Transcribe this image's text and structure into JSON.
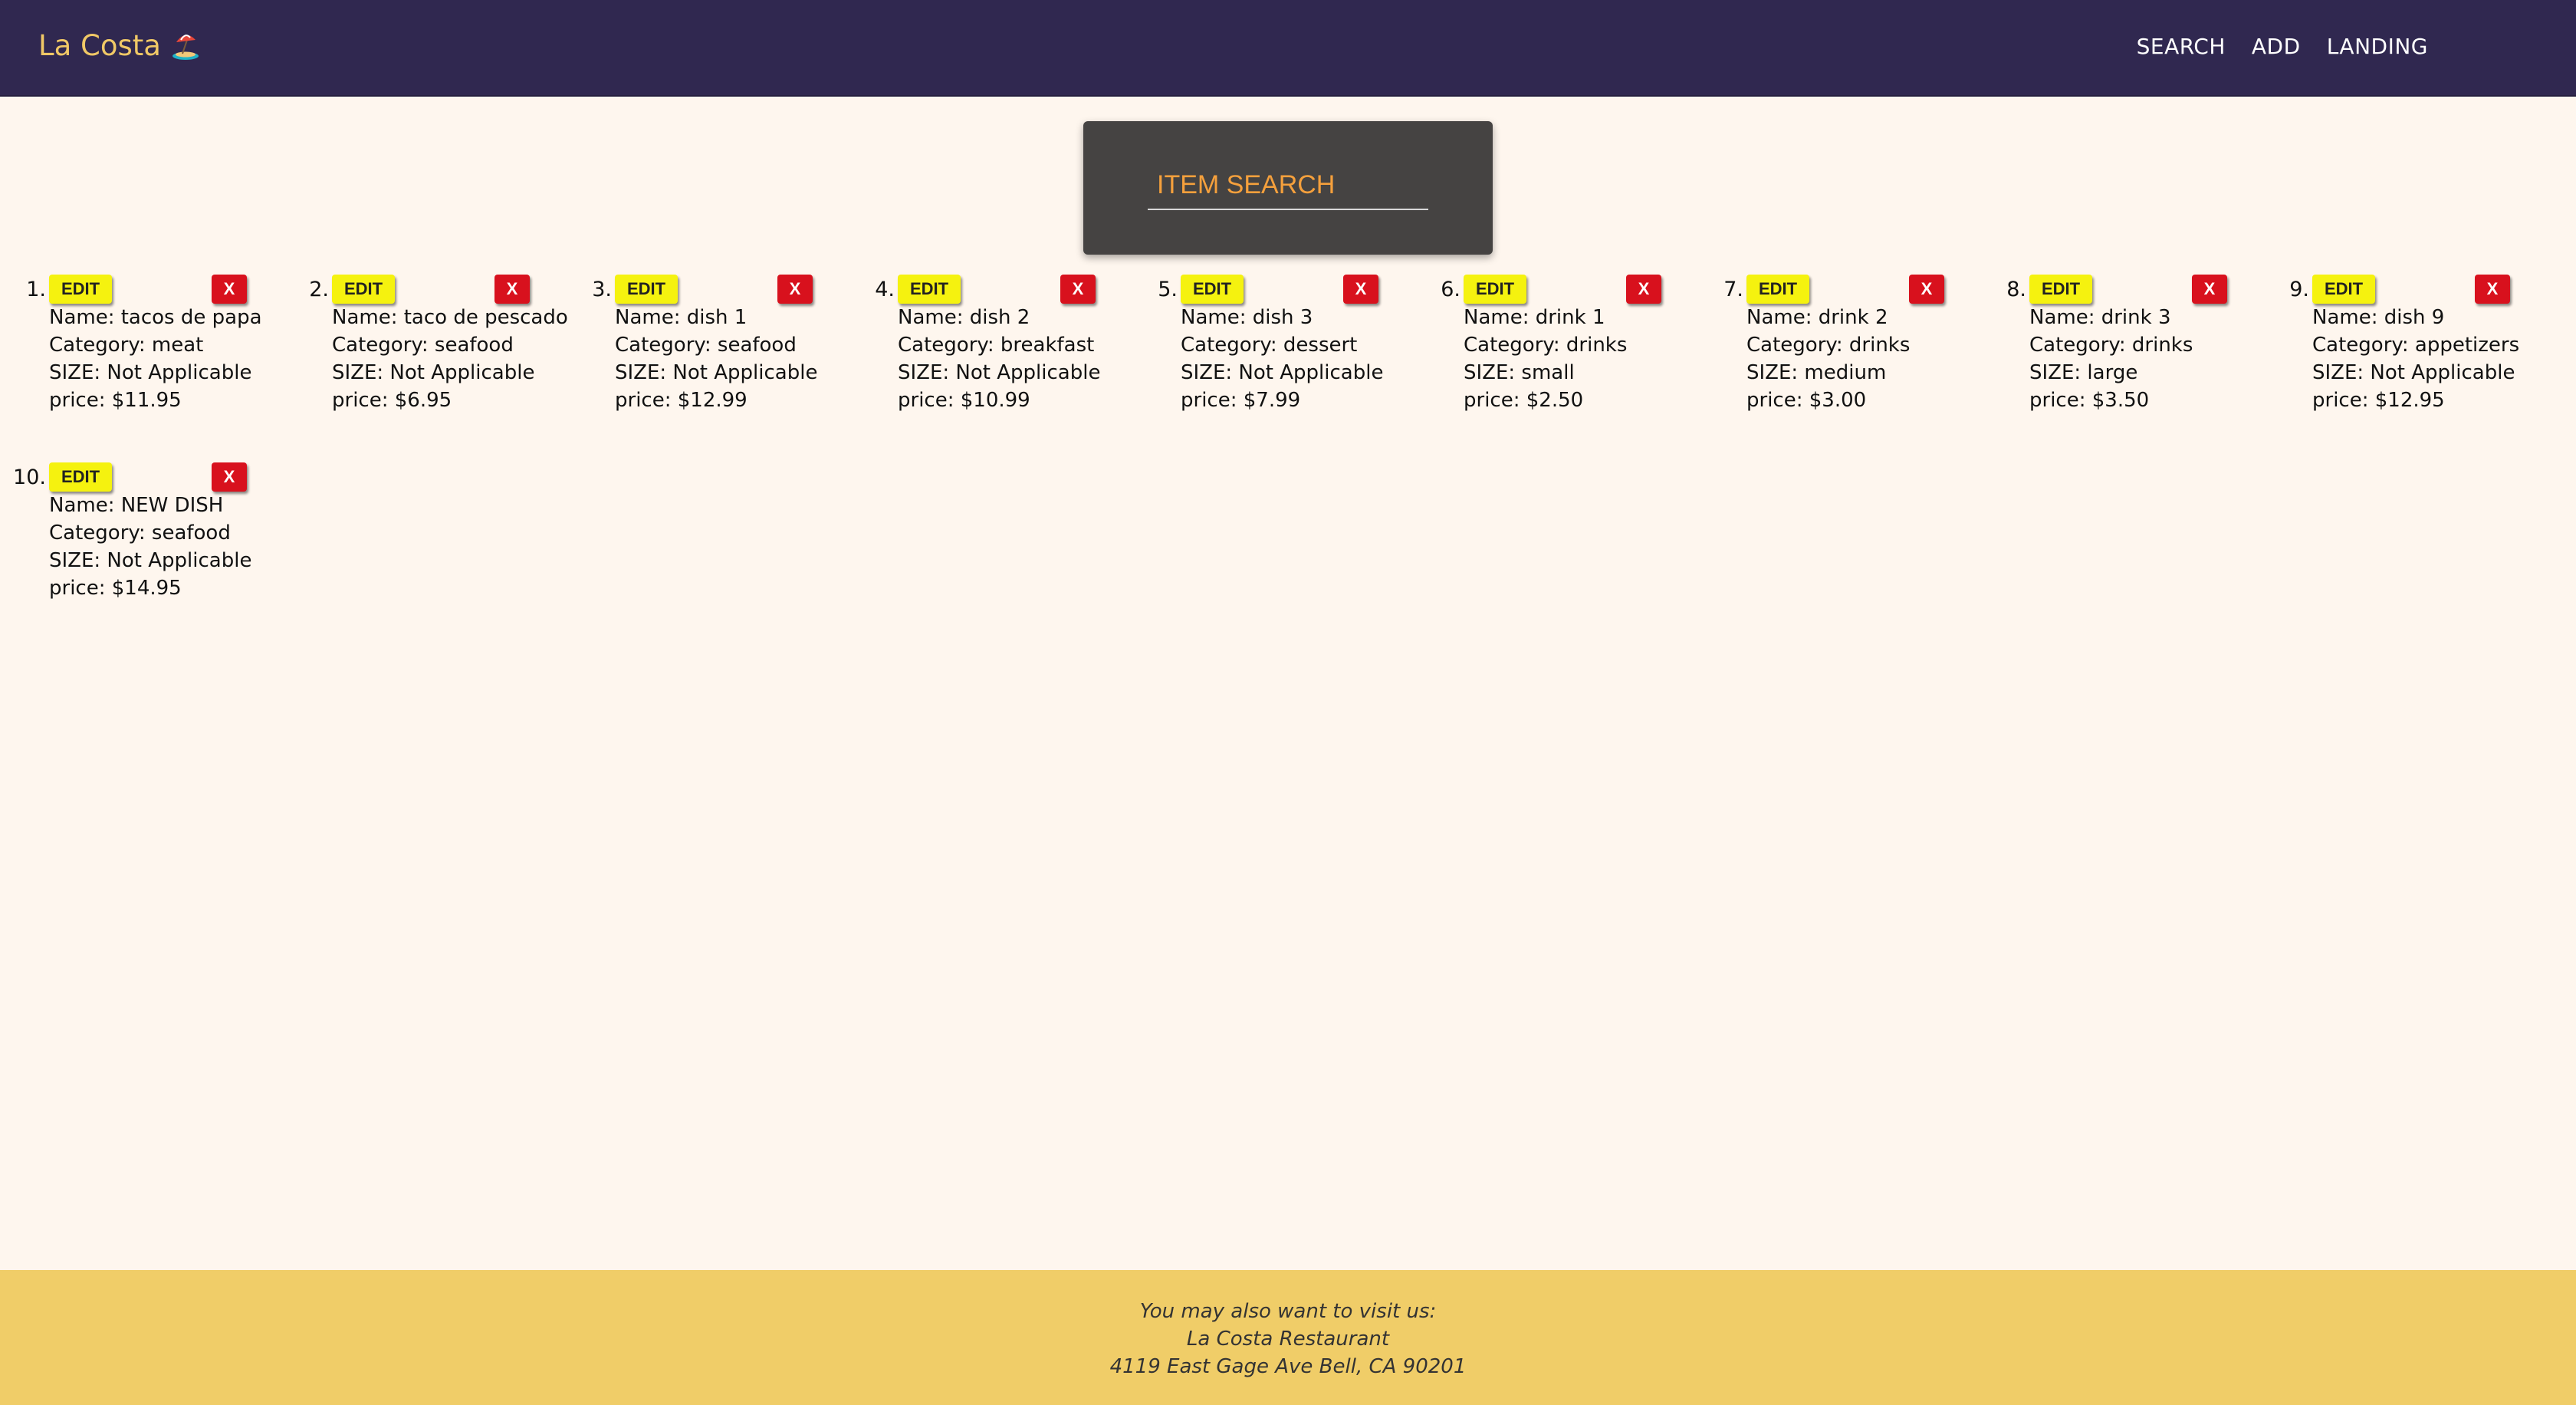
{
  "header": {
    "brand": "La Costa",
    "brand_icon": "beach-umbrella-icon",
    "nav": [
      "SEARCH",
      "ADD",
      "LANDING"
    ]
  },
  "search": {
    "placeholder": "ITEM SEARCH",
    "value": ""
  },
  "items": [
    {
      "index": "1.",
      "edit": "EDIT",
      "delete": "X",
      "name": "Name: tacos de papa",
      "category": "Category: meat",
      "size": "SIZE: Not Applicable",
      "price": "price: $11.95"
    },
    {
      "index": "2.",
      "edit": "EDIT",
      "delete": "X",
      "name": "Name: taco de pescado",
      "category": "Category: seafood",
      "size": "SIZE: Not Applicable",
      "price": "price: $6.95"
    },
    {
      "index": "3.",
      "edit": "EDIT",
      "delete": "X",
      "name": "Name: dish 1",
      "category": "Category: seafood",
      "size": "SIZE: Not Applicable",
      "price": "price: $12.99"
    },
    {
      "index": "4.",
      "edit": "EDIT",
      "delete": "X",
      "name": "Name: dish 2",
      "category": "Category: breakfast",
      "size": "SIZE: Not Applicable",
      "price": "price: $10.99"
    },
    {
      "index": "5.",
      "edit": "EDIT",
      "delete": "X",
      "name": "Name: dish 3",
      "category": "Category: dessert",
      "size": "SIZE: Not Applicable",
      "price": "price: $7.99"
    },
    {
      "index": "6.",
      "edit": "EDIT",
      "delete": "X",
      "name": "Name: drink 1",
      "category": "Category: drinks",
      "size": "SIZE: small",
      "price": "price: $2.50"
    },
    {
      "index": "7.",
      "edit": "EDIT",
      "delete": "X",
      "name": "Name: drink 2",
      "category": "Category: drinks",
      "size": "SIZE: medium",
      "price": "price: $3.00"
    },
    {
      "index": "8.",
      "edit": "EDIT",
      "delete": "X",
      "name": "Name: drink 3",
      "category": "Category: drinks",
      "size": "SIZE: large",
      "price": "price: $3.50"
    },
    {
      "index": "9.",
      "edit": "EDIT",
      "delete": "X",
      "name": "Name: dish 9",
      "category": "Category: appetizers",
      "size": "SIZE: Not Applicable",
      "price": "price: $12.95"
    },
    {
      "index": "10.",
      "edit": "EDIT",
      "delete": "X",
      "name": "Name: NEW DISH",
      "category": "Category: seafood",
      "size": "SIZE: Not Applicable",
      "price": "price: $14.95"
    }
  ],
  "footer": {
    "line1": "You may also want to visit us:",
    "line2": "La Costa Restaurant",
    "line3": "4119 East Gage Ave Bell, CA 90201"
  },
  "colors": {
    "navbar": "#302850",
    "brand": "#f0c866",
    "page_bg": "#fef6ee",
    "search_panel": "#454342",
    "search_text": "#f5a03c",
    "edit_button": "#f5f20f",
    "delete_button": "#d8111d",
    "footer": "#f0cd68"
  }
}
